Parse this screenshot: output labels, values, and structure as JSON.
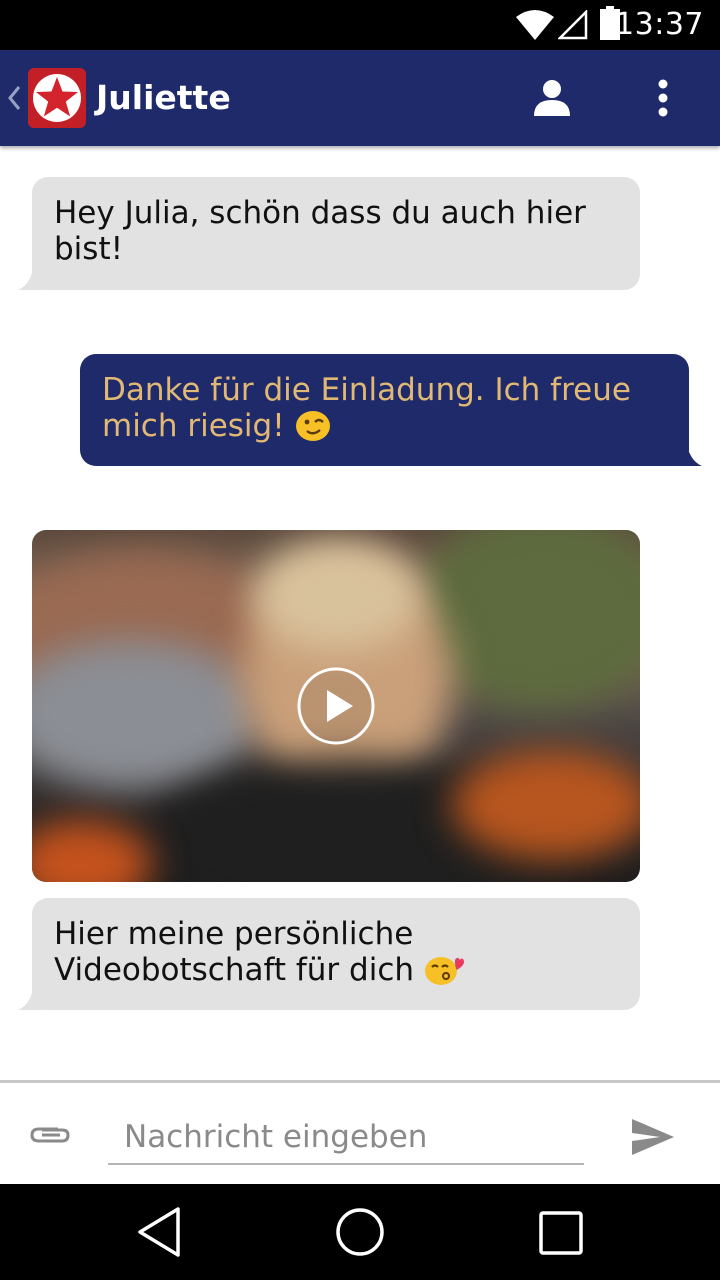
{
  "status_bar": {
    "time": "13:37",
    "icons": [
      "wifi-icon",
      "cellular-signal-icon",
      "battery-icon"
    ]
  },
  "app_bar": {
    "contact_name": "Juliette",
    "icons": [
      "back-chevron-icon",
      "app-logo-star-icon",
      "profile-icon",
      "more-vert-icon"
    ]
  },
  "colors": {
    "app_bar": "#1f2a6b",
    "incoming_bubble": "#e2e2e2",
    "outgoing_bubble": "#1f2a6b",
    "outgoing_text": "#e1b874",
    "logo_red": "#d3232c"
  },
  "messages": [
    {
      "direction": "incoming",
      "text": "Hey Julia, schön dass du auch hier bist!"
    },
    {
      "direction": "outgoing",
      "text": "Danke für die Einladung. Ich freue mich riesig!",
      "emoji": "winking-face-icon"
    },
    {
      "direction": "incoming",
      "type": "video",
      "icon": "play-icon"
    },
    {
      "direction": "incoming",
      "text": "Hier meine persönliche Videobotschaft für dich",
      "emoji": "kissing-heart-face-icon"
    }
  ],
  "composer": {
    "placeholder": "Nachricht eingeben",
    "value": "",
    "icons": [
      "paperclip-icon",
      "send-icon"
    ]
  },
  "nav_bar": {
    "icons": [
      "back-triangle-icon",
      "home-circle-icon",
      "recents-square-icon"
    ]
  }
}
